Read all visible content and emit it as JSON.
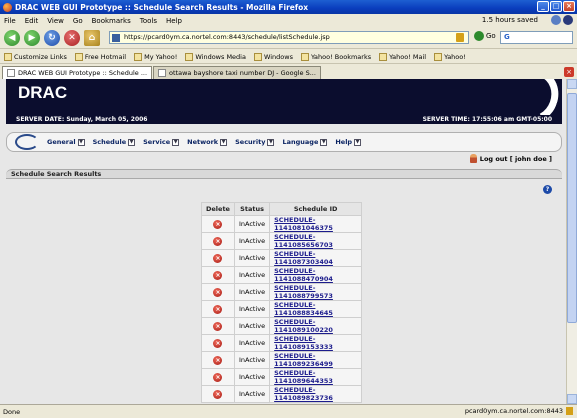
{
  "window": {
    "title": "DRAC WEB GUI Prototype :: Schedule Search Results - Mozilla Firefox"
  },
  "menu": {
    "items": [
      "File",
      "Edit",
      "View",
      "Go",
      "Bookmarks",
      "Tools",
      "Help"
    ],
    "saved": "1.5 hours saved"
  },
  "nav": {
    "url": "https://pcard0ym.ca.nortel.com:8443/schedule/listSchedule.jsp",
    "go_label": "Go",
    "search_value": "G"
  },
  "bookmarks": [
    "Customize Links",
    "Free Hotmail",
    "My Yahoo!",
    "Windows Media",
    "Windows",
    "Yahoo! Bookmarks",
    "Yahoo! Mail",
    "Yahoo!"
  ],
  "tabs": [
    {
      "label": "DRAC WEB GUI Prototype :: Schedule ..."
    },
    {
      "label": "ottawa bayshore taxi number DJ - Google S..."
    }
  ],
  "page": {
    "logo": "DRAC",
    "server_date": "SERVER DATE: Sunday, March 05, 2006",
    "server_time": "SERVER TIME: 17:55:06 am GMT-05:00",
    "menu": [
      "General",
      "Schedule",
      "Service",
      "Network",
      "Security",
      "Language",
      "Help"
    ],
    "logout": "Log out [ john doe ]",
    "section_title": "Schedule Search Results",
    "table": {
      "headers": [
        "Delete",
        "Status",
        "Schedule ID"
      ],
      "rows": [
        {
          "status": "InActive",
          "id": "SCHEDULE-1141081046375"
        },
        {
          "status": "InActive",
          "id": "SCHEDULE-1141085656703"
        },
        {
          "status": "InActive",
          "id": "SCHEDULE-1141087303404"
        },
        {
          "status": "InActive",
          "id": "SCHEDULE-1141088470904"
        },
        {
          "status": "InActive",
          "id": "SCHEDULE-1141088799573"
        },
        {
          "status": "InActive",
          "id": "SCHEDULE-1141088834645"
        },
        {
          "status": "InActive",
          "id": "SCHEDULE-1141089100220"
        },
        {
          "status": "InActive",
          "id": "SCHEDULE-1141089153333"
        },
        {
          "status": "InActive",
          "id": "SCHEDULE-1141089236499"
        },
        {
          "status": "InActive",
          "id": "SCHEDULE-1141089644353"
        },
        {
          "status": "InActive",
          "id": "SCHEDULE-1141089823736"
        }
      ]
    }
  },
  "status": {
    "left": "Done",
    "right": "pcard0ym.ca.nortel.com:8443"
  }
}
